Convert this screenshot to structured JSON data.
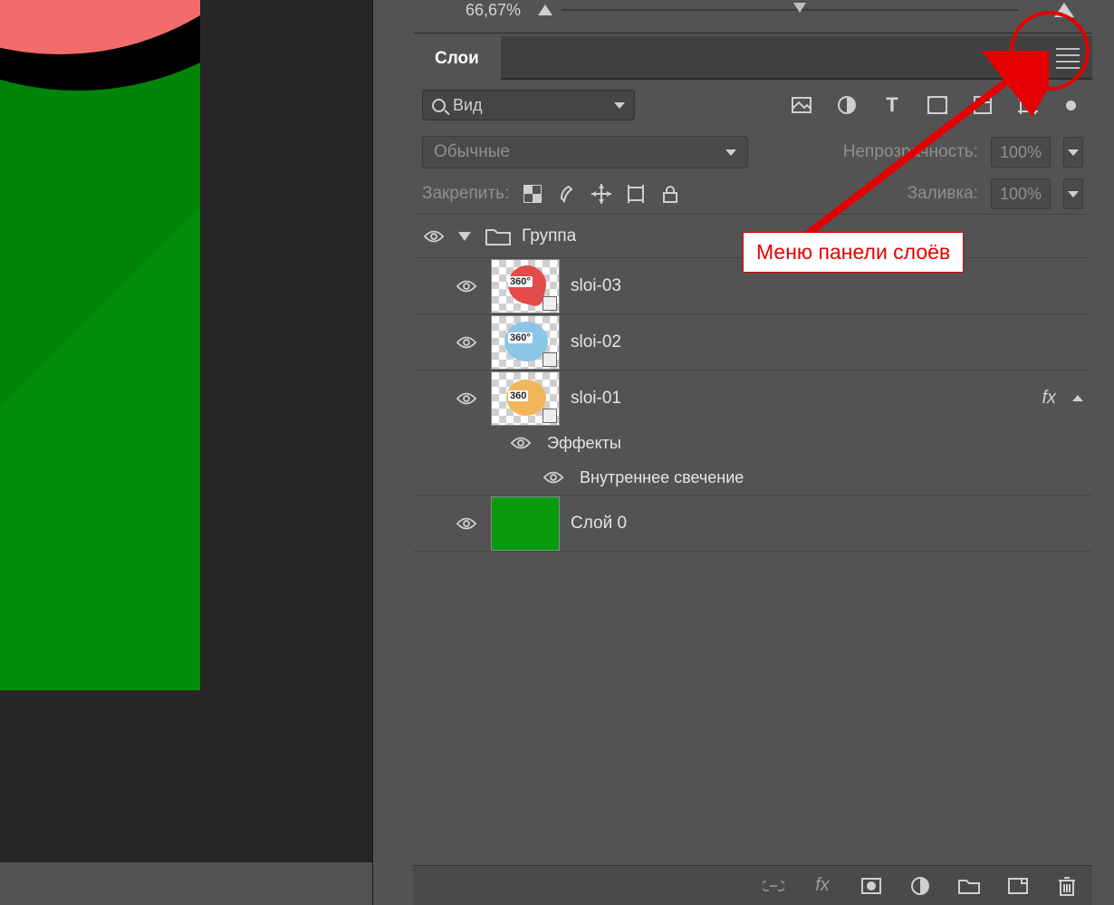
{
  "zoom": {
    "value": "66,67%"
  },
  "panel_tab": {
    "title": "Слои"
  },
  "search": {
    "label": "Вид"
  },
  "filters": {
    "icons": [
      "image",
      "adjustment",
      "text",
      "shape",
      "smartobject",
      "artboard"
    ]
  },
  "blend": {
    "mode": "Обычные",
    "opacity_label": "Непрозрачность:",
    "opacity_value": "100%"
  },
  "lock": {
    "label": "Закрепить:",
    "fill_label": "Заливка:",
    "fill_value": "100%"
  },
  "group": {
    "name": "Группа"
  },
  "layers": [
    {
      "name": "sloi-03",
      "kind": "smart",
      "fx": false
    },
    {
      "name": "sloi-02",
      "kind": "smart",
      "fx": false
    },
    {
      "name": "sloi-01",
      "kind": "smart",
      "fx": true
    },
    {
      "name": "Слой 0",
      "kind": "pixel",
      "fx": false
    }
  ],
  "effects": {
    "heading": "Эффекты",
    "items": [
      "Внутреннее свечение"
    ]
  },
  "annotation": {
    "label": "Меню панели слоёв"
  },
  "actionbar": {
    "icons": [
      "link",
      "fx",
      "mask",
      "adjustment-circle",
      "group",
      "new-layer",
      "trash"
    ]
  }
}
